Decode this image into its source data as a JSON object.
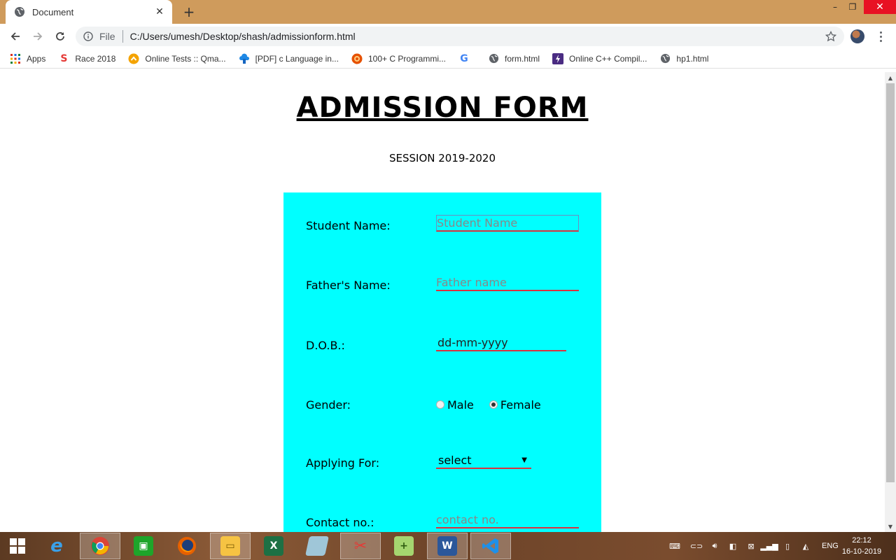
{
  "browser": {
    "tab_title": "Document",
    "tab_close": "✕",
    "new_tab": "+",
    "window_controls": {
      "minimize": "–",
      "restore": "❐",
      "close": "✕"
    },
    "scheme": "File",
    "url": "C:/Users/umesh/Desktop/shash/admissionform.html"
  },
  "bookmarks": [
    {
      "label": "Apps",
      "icon": "apps-grid-icon"
    },
    {
      "label": "Race 2018",
      "icon": "race-s-icon"
    },
    {
      "label": "Online Tests :: Qma...",
      "icon": "online-tests-icon"
    },
    {
      "label": "[PDF] c Language in...",
      "icon": "pdf-cloud-icon"
    },
    {
      "label": "100+ C Programmi...",
      "icon": "programming-site-icon"
    },
    {
      "label": "",
      "icon": "google-icon"
    },
    {
      "label": "form.html",
      "icon": "globe-icon"
    },
    {
      "label": "Online C++ Compil...",
      "icon": "bolt-icon"
    },
    {
      "label": "hp1.html",
      "icon": "globe-icon"
    }
  ],
  "page": {
    "title": "ADMISSION FORM",
    "session": "SESSION 2019-2020",
    "form": {
      "student_name": {
        "label": "Student Name:",
        "placeholder": "Student Name"
      },
      "father_name": {
        "label": "Father's Name:",
        "placeholder": "Father name"
      },
      "dob": {
        "label": "D.O.B.:",
        "value": "dd-mm-yyyy"
      },
      "gender": {
        "label": "Gender:",
        "options": [
          "Male",
          "Female"
        ],
        "selected": "Female"
      },
      "applying_for": {
        "label": "Applying For:",
        "selected": "select"
      },
      "contact": {
        "label": "Contact no.:",
        "placeholder": "contact no."
      }
    },
    "panel_color": "#00ffff"
  },
  "taskbar": {
    "apps": [
      "start",
      "internet-explorer",
      "chrome",
      "store",
      "firefox",
      "file-explorer",
      "excel",
      "app",
      "snipping-tool",
      "notepad-plus",
      "word",
      "vscode"
    ],
    "language": "ENG",
    "time": "22:12",
    "date": "16-10-2019"
  }
}
